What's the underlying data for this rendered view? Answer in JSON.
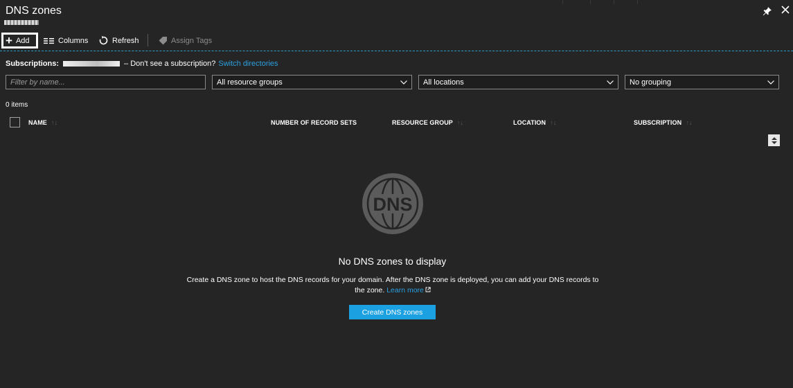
{
  "header": {
    "title": "DNS zones",
    "pin_icon": "pin-icon",
    "close_icon": "close-icon"
  },
  "toolbar": {
    "add_label": "Add",
    "columns_label": "Columns",
    "refresh_label": "Refresh",
    "assign_tags_label": "Assign Tags"
  },
  "subscriptions": {
    "label": "Subscriptions:",
    "prompt": "– Don't see a subscription?",
    "link": "Switch directories"
  },
  "filters": {
    "name_placeholder": "Filter by name...",
    "resource_group": "All resource groups",
    "location": "All locations",
    "grouping": "No grouping"
  },
  "list": {
    "count": "0 items",
    "columns": [
      "NAME",
      "NUMBER OF RECORD SETS",
      "RESOURCE GROUP",
      "LOCATION",
      "SUBSCRIPTION"
    ]
  },
  "empty_state": {
    "icon_text": "DNS",
    "title": "No DNS zones to display",
    "description": "Create a DNS zone to host the DNS records for your domain. After the DNS zone is deployed, you can add your DNS records to the zone.",
    "learn_more": "Learn more",
    "button": "Create DNS zones"
  },
  "colors": {
    "background": "#252526",
    "accent": "#1ba1e2",
    "link": "#2aa0e0"
  }
}
